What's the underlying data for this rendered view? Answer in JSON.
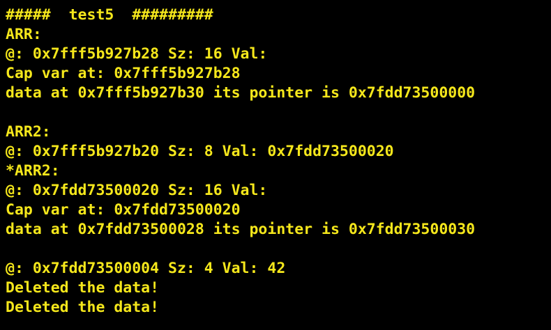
{
  "terminal": {
    "text_color": "#f5e71b",
    "background_color": "#000000",
    "lines": [
      "#####  test5  #########",
      "ARR:",
      "@: 0x7fff5b927b28 Sz: 16 Val:",
      "Cap var at: 0x7fff5b927b28",
      "data at 0x7fff5b927b30 its pointer is 0x7fdd73500000",
      "",
      "ARR2:",
      "@: 0x7fff5b927b20 Sz: 8 Val: 0x7fdd73500020",
      "*ARR2:",
      "@: 0x7fdd73500020 Sz: 16 Val:",
      "Cap var at: 0x7fdd73500020",
      "data at 0x7fdd73500028 its pointer is 0x7fdd73500030",
      "",
      "@: 0x7fdd73500004 Sz: 4 Val: 42",
      "Deleted the data!",
      "Deleted the data!"
    ]
  }
}
